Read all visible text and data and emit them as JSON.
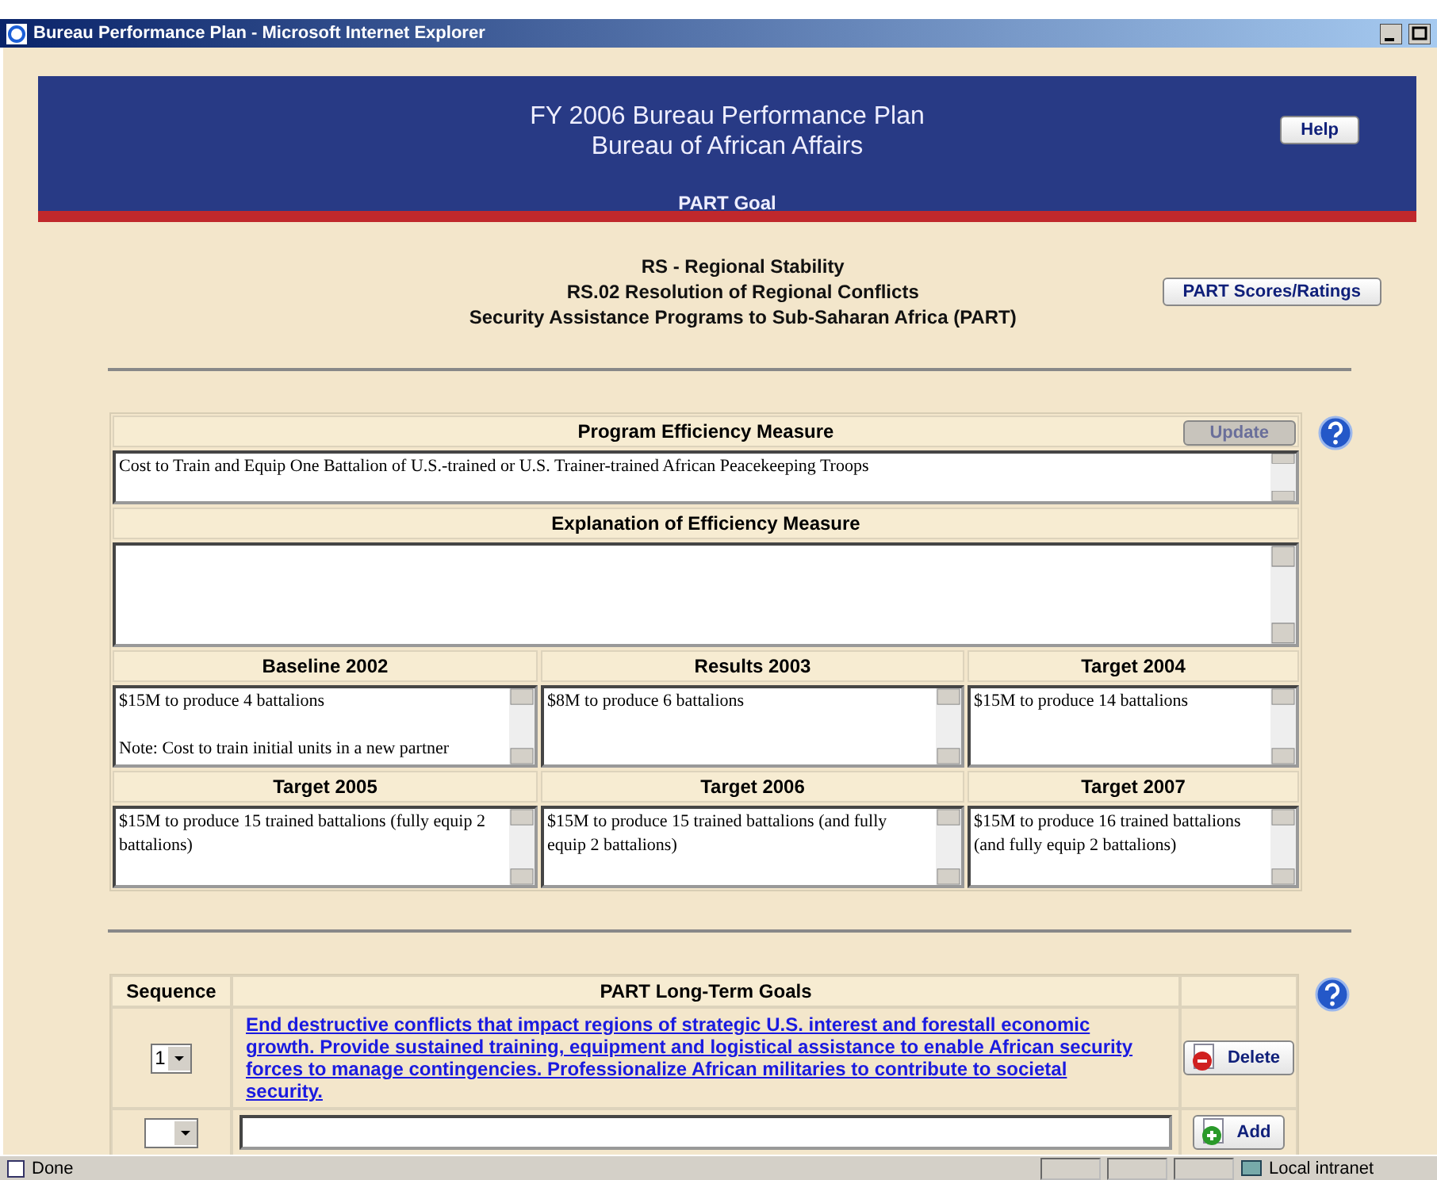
{
  "window": {
    "title": "Bureau Performance Plan - Microsoft Internet Explorer"
  },
  "banner": {
    "title_lines": [
      "FY 2006 Bureau Performance Plan",
      "Bureau of African Affairs"
    ],
    "subtitle": "PART Goal",
    "help_button": "Help"
  },
  "headings": [
    "RS - Regional Stability",
    "RS.02 Resolution of Regional Conflicts",
    "Security Assistance Programs to Sub-Saharan Africa (PART)"
  ],
  "scores_button": "PART Scores/Ratings",
  "efficiency": {
    "header": "Program Efficiency Measure",
    "update_button": {
      "label": "Update",
      "disabled": true
    },
    "measure": "Cost to Train and Equip One Battalion of U.S.-trained or U.S. Trainer-trained African Peacekeeping Troops",
    "explanation_header": "Explanation of Efficiency Measure",
    "cells": [
      {
        "label": "Baseline 2002",
        "value": "$15M to produce 4 battalions\n\nNote: Cost to train initial units in a new partner"
      },
      {
        "label": "Results 2003",
        "value": "$8M to produce 6 battalions"
      },
      {
        "label": "Target 2004",
        "value": "$15M to produce 14 battalions"
      },
      {
        "label": "Target 2005",
        "value": "$15M to produce 15 trained battalions (fully equip 2 battalions)"
      },
      {
        "label": "Target 2006",
        "value": "$15M to produce 15 trained battalions (and fully equip 2 battalions)"
      },
      {
        "label": "Target 2007",
        "value": "$15M to produce 16 trained battalions (and fully equip 2 battalions)"
      }
    ]
  },
  "goals": {
    "columns": [
      "Sequence",
      "PART Long-Term Goals"
    ],
    "rows": [
      {
        "kind": "existing",
        "sequence": "1",
        "goal": "End destructive conflicts that impact regions of strategic U.S. interest and forestall economic growth. Provide sustained training, equipment and logistical assistance to enable African security forces to manage contingencies. Professionalize African militaries to contribute to societal security.",
        "action": "Delete"
      },
      {
        "kind": "new",
        "action": "Add"
      }
    ]
  },
  "status_bar": {
    "text": "Done",
    "zone": "Local intranet"
  }
}
